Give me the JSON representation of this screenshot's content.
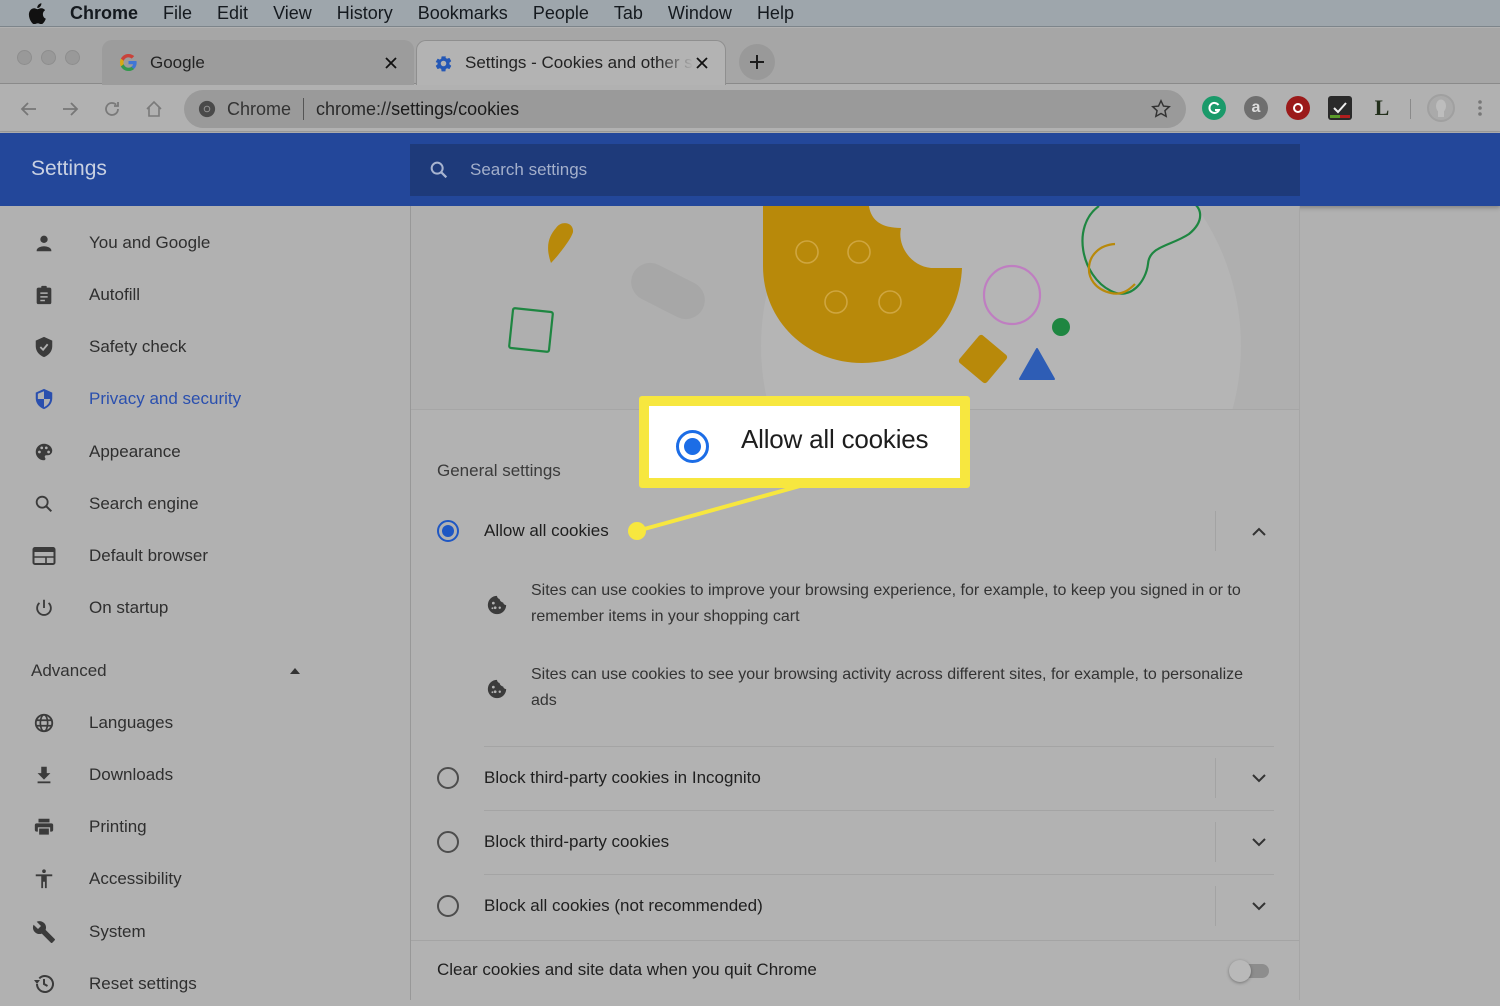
{
  "menubar": {
    "app_name": "Chrome",
    "items": [
      "File",
      "Edit",
      "View",
      "History",
      "Bookmarks",
      "People",
      "Tab",
      "Window",
      "Help"
    ]
  },
  "tabs": [
    {
      "title": "Google",
      "favicon": "google-icon",
      "active": false
    },
    {
      "title": "Settings - Cookies and other site data",
      "favicon": "gear-icon",
      "active": true
    }
  ],
  "toolbar": {
    "omnibox_site_label": "Chrome",
    "url_scheme": "chrome://",
    "url_path": "settings/cookies",
    "extensions": [
      "grammarly-icon",
      "a-extension-icon",
      "red-extension-icon",
      "checklist-extension-icon",
      "l-extension-icon"
    ]
  },
  "settings_header": {
    "title": "Settings",
    "search_placeholder": "Search settings"
  },
  "sidebar": {
    "items": [
      {
        "label": "You and Google",
        "icon": "person-icon"
      },
      {
        "label": "Autofill",
        "icon": "clipboard-icon"
      },
      {
        "label": "Safety check",
        "icon": "shield-check-icon"
      },
      {
        "label": "Privacy and security",
        "icon": "privacy-shield-icon",
        "active": true
      },
      {
        "label": "Appearance",
        "icon": "palette-icon"
      },
      {
        "label": "Search engine",
        "icon": "search-icon"
      },
      {
        "label": "Default browser",
        "icon": "browser-window-icon"
      },
      {
        "label": "On startup",
        "icon": "power-icon"
      }
    ],
    "advanced_label": "Advanced",
    "advanced_items": [
      {
        "label": "Languages",
        "icon": "globe-icon"
      },
      {
        "label": "Downloads",
        "icon": "download-icon"
      },
      {
        "label": "Printing",
        "icon": "printer-icon"
      },
      {
        "label": "Accessibility",
        "icon": "accessibility-icon"
      },
      {
        "label": "System",
        "icon": "wrench-icon"
      },
      {
        "label": "Reset settings",
        "icon": "history-icon"
      }
    ]
  },
  "main": {
    "section_title": "General settings",
    "options": [
      {
        "label": "Allow all cookies",
        "checked": true,
        "expanded": true
      },
      {
        "label": "Block third-party cookies in Incognito",
        "checked": false,
        "expanded": false
      },
      {
        "label": "Block third-party cookies",
        "checked": false,
        "expanded": false
      },
      {
        "label": "Block all cookies (not recommended)",
        "checked": false,
        "expanded": false
      }
    ],
    "allow_all_descriptions": [
      "Sites can use cookies to improve your browsing experience, for example, to keep you signed in or to remember items in your shopping cart",
      "Sites can use cookies to see your browsing activity across different sites, for example, to personalize ads"
    ],
    "clear_on_quit_label": "Clear cookies and site data when you quit Chrome",
    "clear_on_quit_enabled": false
  },
  "callout": {
    "text": "Allow all cookies",
    "color": "#f7e73f"
  },
  "colors": {
    "header_blue": "#23479a",
    "search_blue": "#1e3a7a",
    "active_nav": "#2a4fae",
    "radio_blue": "#1f57c3"
  }
}
